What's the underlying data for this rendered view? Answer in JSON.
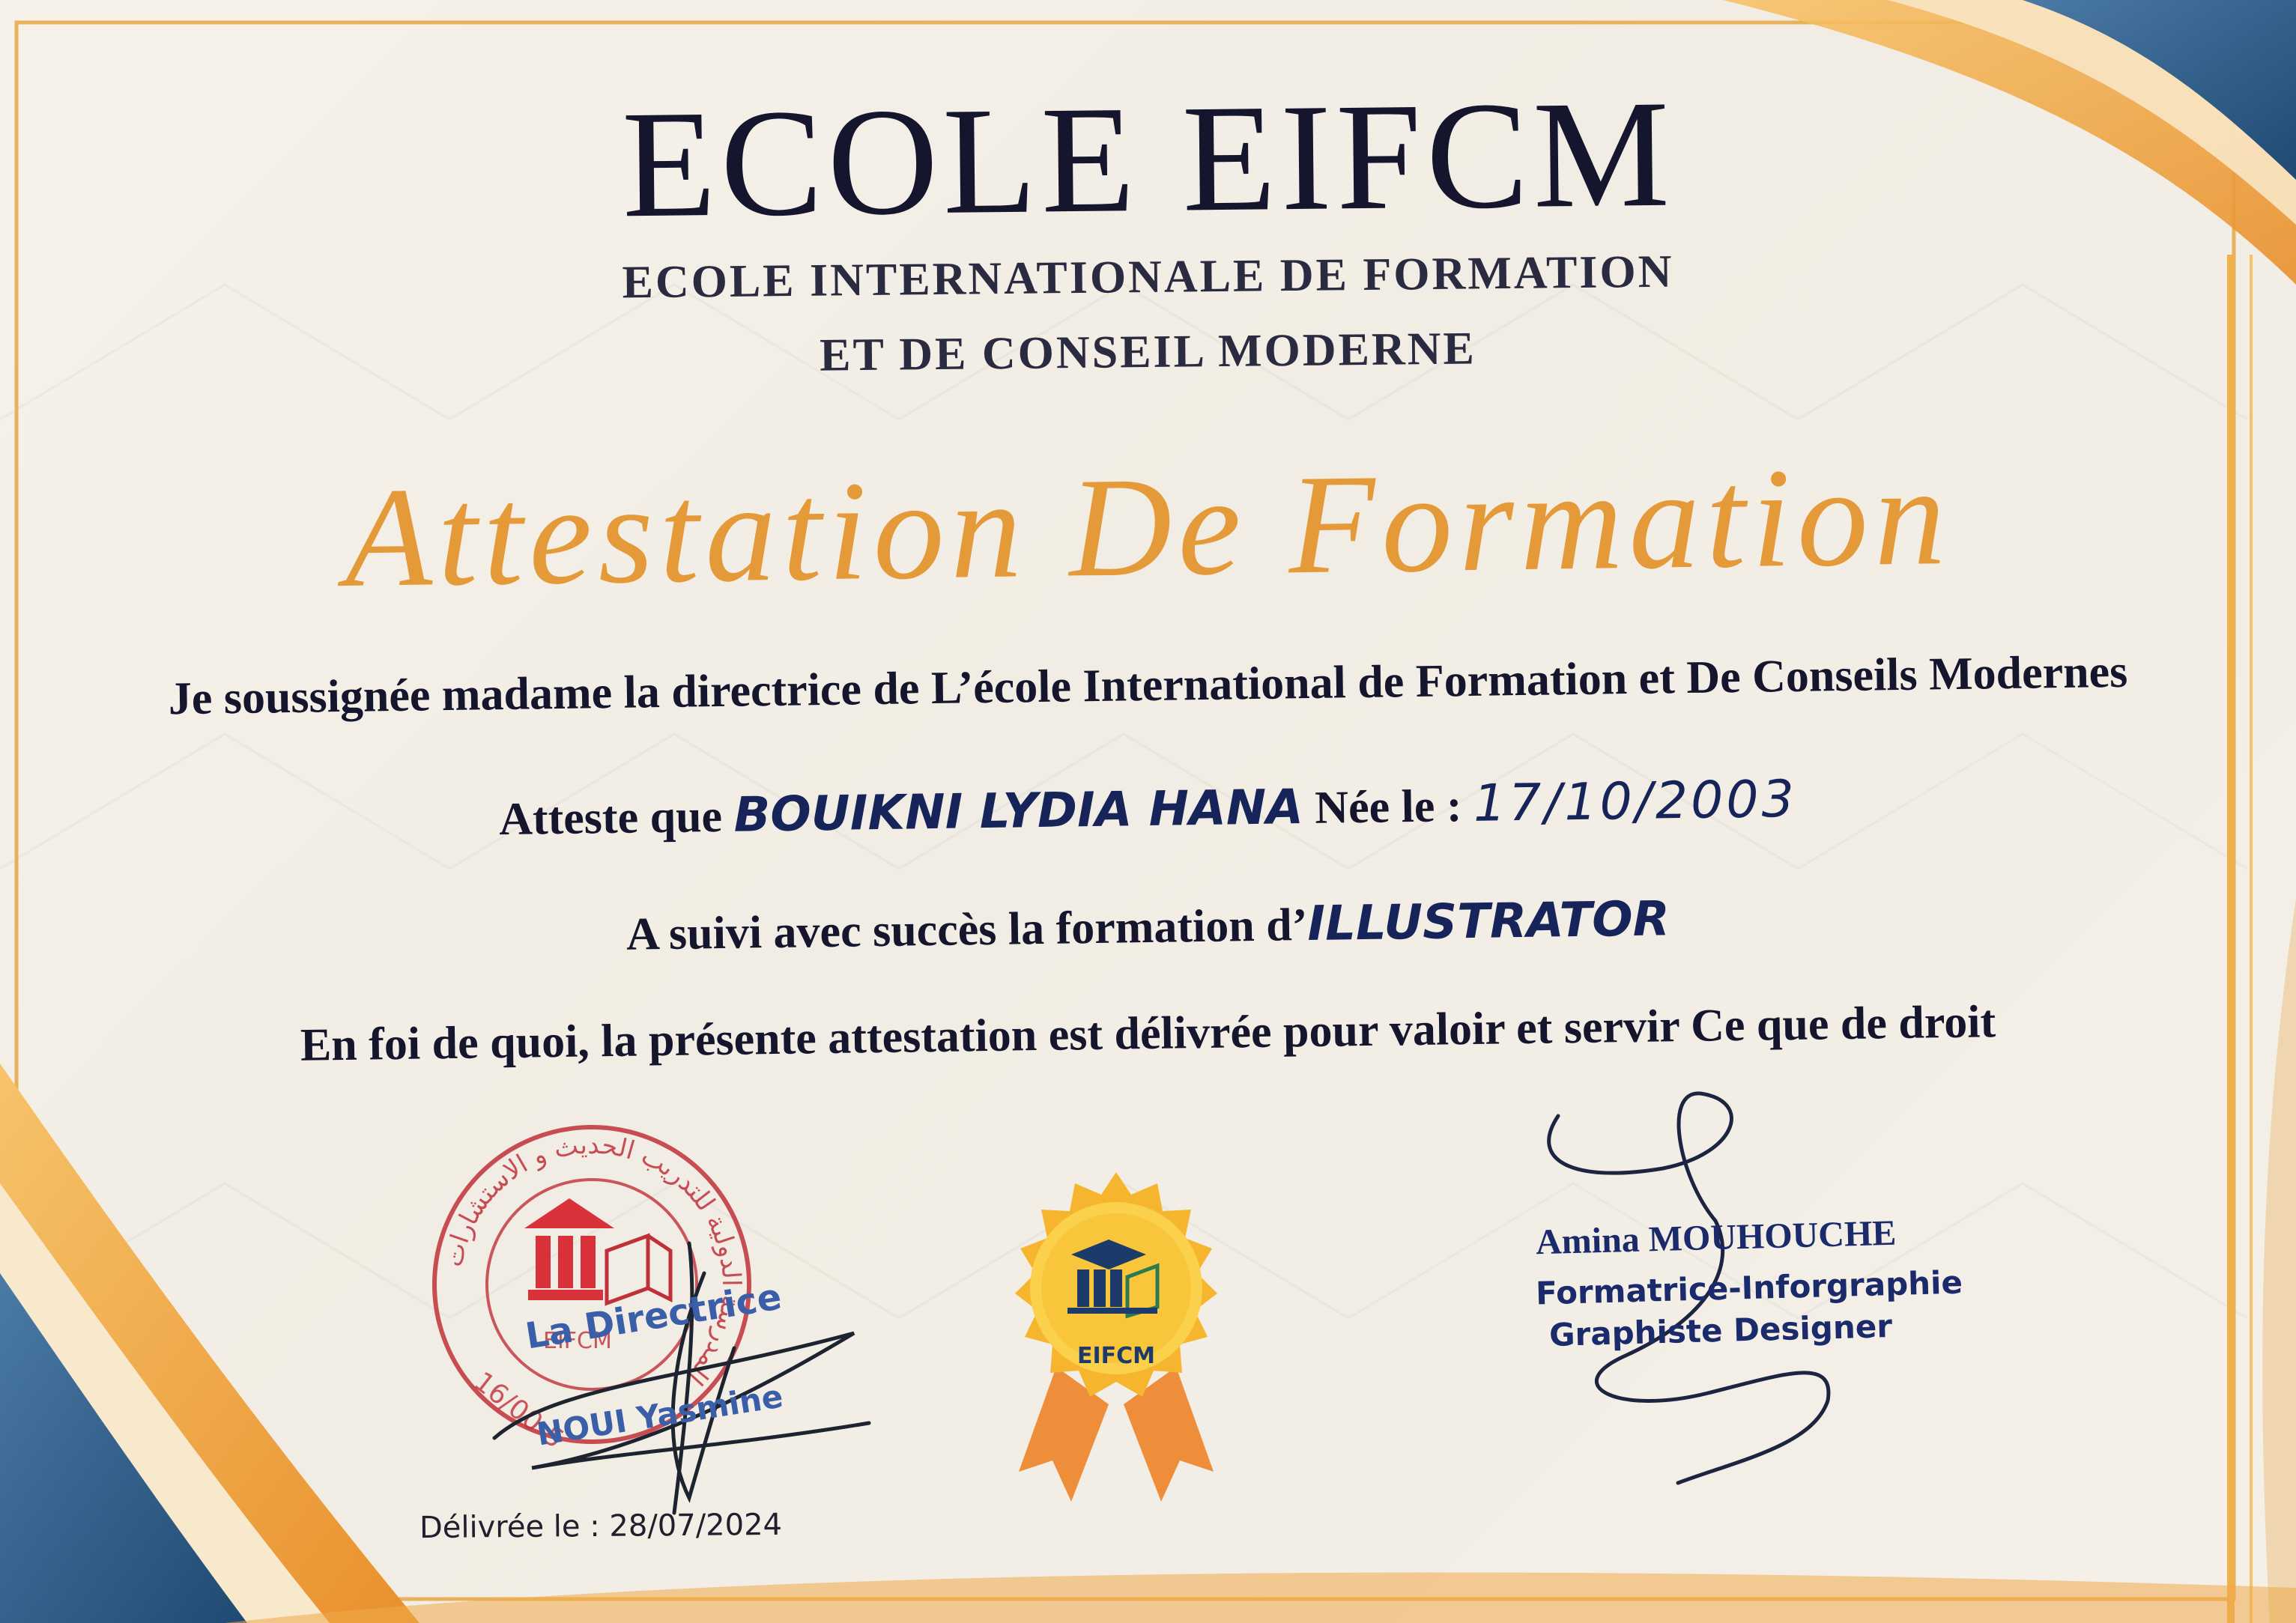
{
  "header": {
    "school_name": "ECOLE EIFCM",
    "school_full_line1": "ECOLE INTERNATIONALE DE FORMATION",
    "school_full_line2": "ET DE CONSEIL MODERNE"
  },
  "title": "Attestation De Formation",
  "body": {
    "line1": "Je soussignée  madame la directrice de L’école International de Formation et  De Conseils Modernes",
    "line2_prefix": "Atteste que ",
    "student_name": "BOUIKNI LYDIA HANA",
    "birth_label": " Née le : ",
    "birth_date": "17/10/2003",
    "line3_prefix": "A suivi avec succès la formation d’",
    "course": "ILLUSTRATOR",
    "line4": "En foi de quoi, la présente attestation est délivrée pour valoir et servir Ce que de droit"
  },
  "stamp": {
    "arabic_ring_text": "المدرسة الدولية للتدريب الحديث و الاستشارات",
    "logo_text": "EIFCM",
    "number_text": "16/00-5"
  },
  "director": {
    "title": "La Directrice",
    "name": "NOUI Yasmine"
  },
  "seal": {
    "label": "EIFCM"
  },
  "trainer": {
    "name": "Amina MOUHOUCHE",
    "role_line1": "Formatrice-Inforgraphie",
    "role_line2": "Graphiste Designer"
  },
  "issued": {
    "text": "Délivrée le : 28/07/2024"
  },
  "colors": {
    "navy_text": "#15162e",
    "gold_title": "#e59a3a",
    "blue_corner": "#2f5d86",
    "orange_wave": "#f0a23c",
    "stamp_red": "#c0303a",
    "handwriting_blue": "#16245a"
  }
}
